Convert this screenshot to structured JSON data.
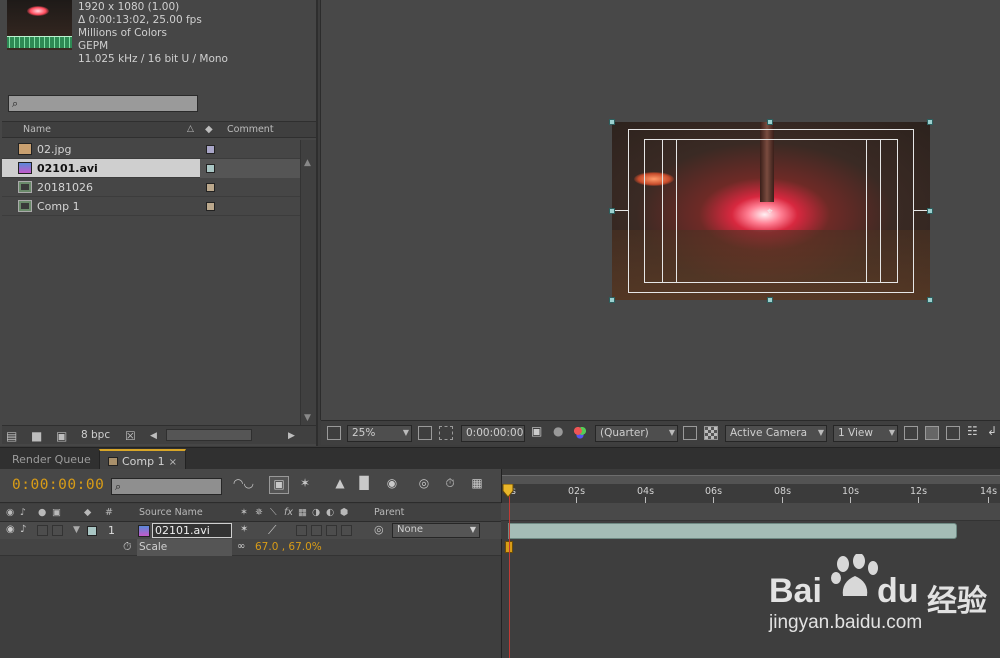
{
  "project": {
    "meta": [
      "1920 x 1080 (1.00)",
      "Δ 0:00:13:02, 25.00 fps",
      "Millions of Colors",
      "GEPM",
      "11.025 kHz / 16 bit U / Mono"
    ],
    "columns": {
      "name": "Name",
      "comment": "Comment"
    },
    "files": [
      {
        "name": "02.jpg",
        "type": "image",
        "tag": "#a9a6c8"
      },
      {
        "name": "02101.avi",
        "type": "video",
        "tag": "#a9c6c4"
      },
      {
        "name": "20181026",
        "type": "comp",
        "tag": "#bba88c"
      },
      {
        "name": "Comp 1",
        "type": "comp",
        "tag": "#bba88c"
      }
    ],
    "bpc": "8 bpc"
  },
  "viewer": {
    "zoom": "25%",
    "timecode": "0:00:00:00",
    "resolution": "(Quarter)",
    "camera": "Active Camera",
    "views": "1 View"
  },
  "tabs": [
    {
      "label": "Render Queue",
      "active": false
    },
    {
      "label": "Comp 1",
      "active": true
    }
  ],
  "timeline": {
    "timecode": "0:00:00:00",
    "columns": {
      "num": "#",
      "source": "Source Name",
      "parent": "Parent",
      "fx": "fx"
    },
    "layer": {
      "index": "1",
      "name": "02101.avi",
      "parent": "None"
    },
    "property": {
      "name": "Scale",
      "value": "67.0 , 67.0%"
    },
    "ruler": [
      "0s",
      "02s",
      "04s",
      "06s",
      "08s",
      "10s",
      "12s",
      "14s"
    ]
  },
  "watermark": {
    "brand": "Bai",
    "brand2": "du",
    "cn": "经验",
    "url": "jingyan.baidu.com"
  },
  "colors": {
    "accent": "#d89c17",
    "cti": "#c23a34",
    "layer_bar": "#a4bdb6"
  }
}
